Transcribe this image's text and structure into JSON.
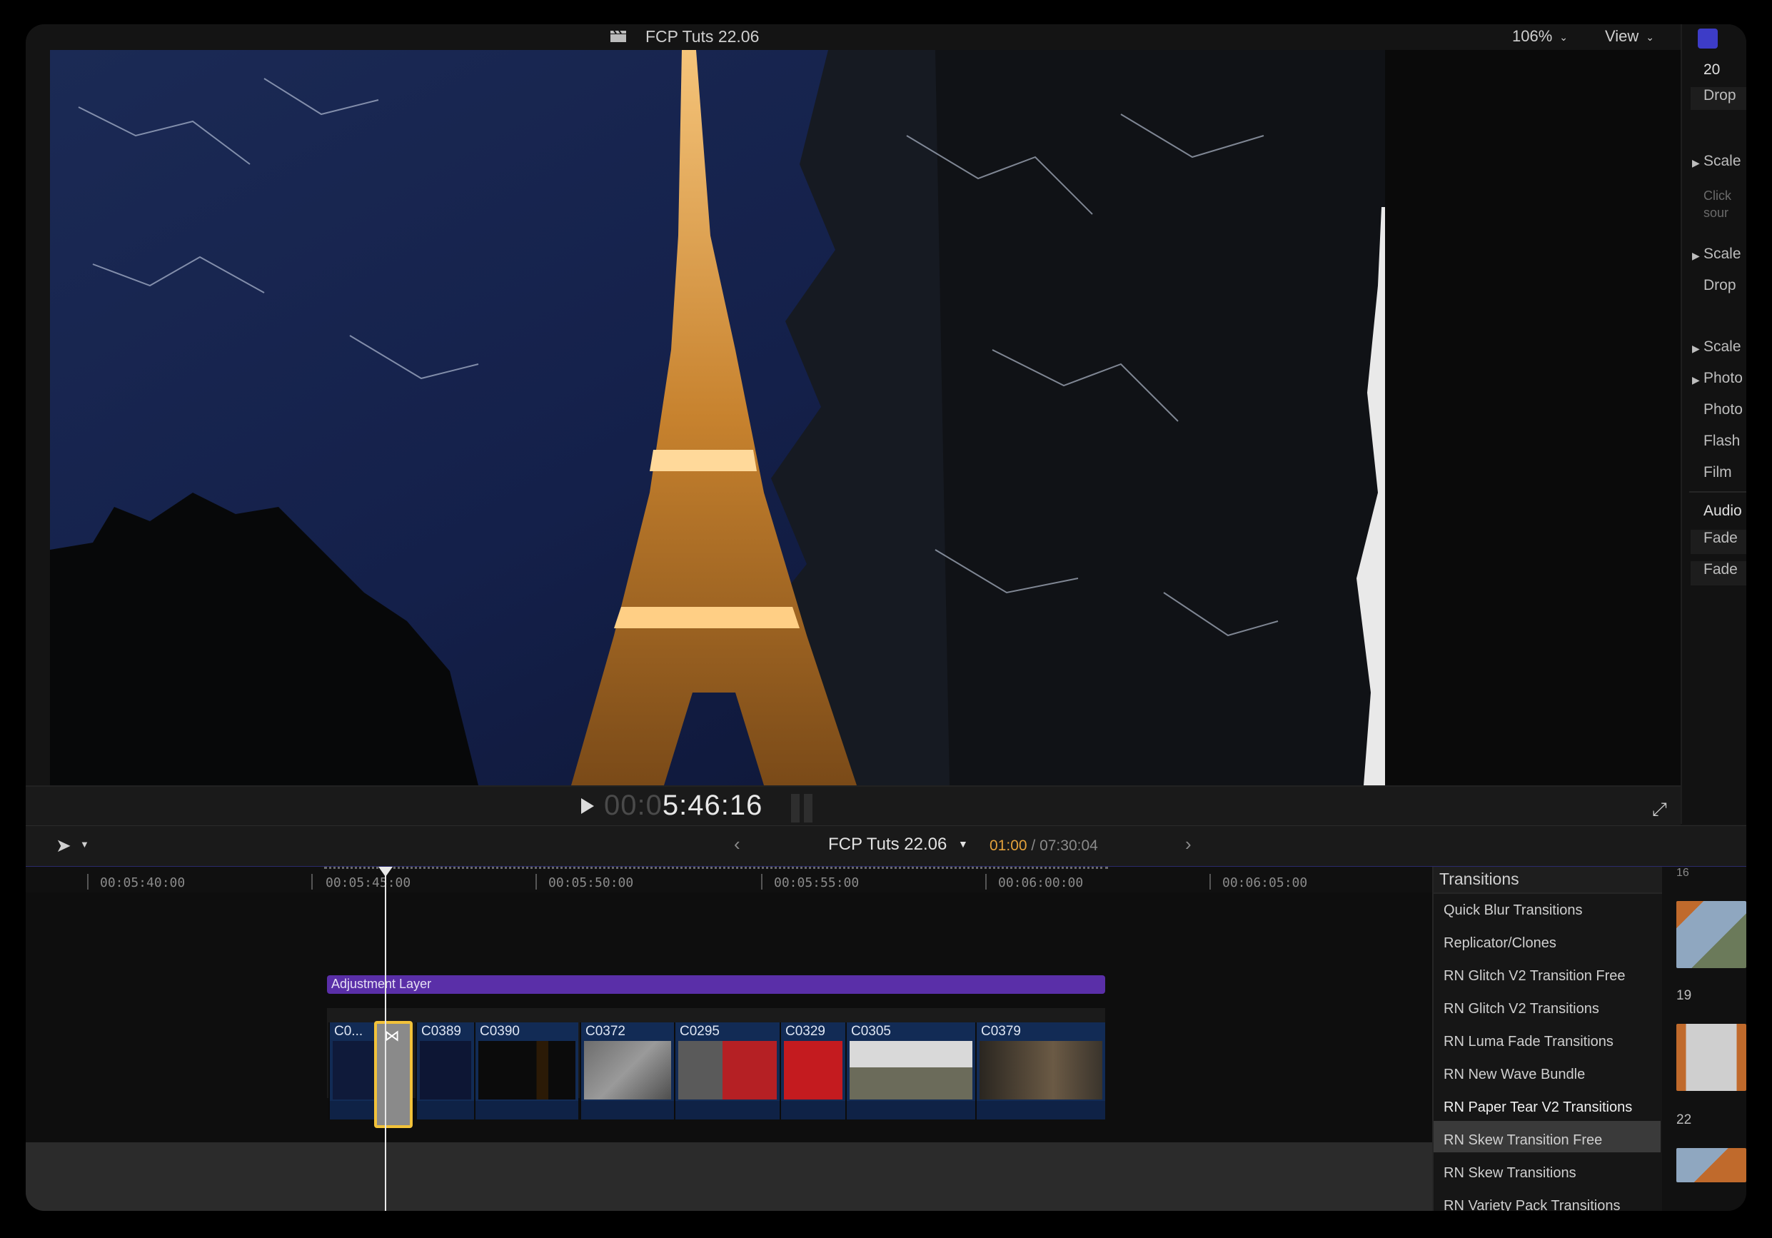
{
  "topbar": {
    "project_title": "FCP Tuts 22.06",
    "zoom_label": "106%",
    "view_label": "View"
  },
  "inspector": {
    "count": "20",
    "rows": [
      "Drop",
      "Scale",
      "Click",
      "sour",
      "Scale",
      "Drop",
      "Scale",
      "Photo",
      "Photo",
      "Flash",
      "Film",
      "Audio",
      "Fade",
      "Fade"
    ]
  },
  "transport": {
    "timecode_dim": "00:0",
    "timecode": "5:46:16"
  },
  "timeline_header": {
    "project": "FCP Tuts 22.06",
    "current": "01:00",
    "separator": " / ",
    "total": "07:30:04"
  },
  "ruler": {
    "labels": [
      "00:05:40:00",
      "00:05:45:00",
      "00:05:50:00",
      "00:05:55:00",
      "00:06:00:00",
      "00:06:05:00"
    ]
  },
  "timeline": {
    "adjustment_layer": "Adjustment Layer",
    "clips": [
      "C0...",
      "C0389",
      "C0390",
      "C0372",
      "C0295",
      "C0329",
      "C0305",
      "C0379"
    ]
  },
  "browser": {
    "title": "Transitions",
    "items": [
      "Quick Blur Transitions",
      "Replicator/Clones",
      "RN Glitch V2 Transition Free",
      "RN Glitch V2 Transitions",
      "RN Luma Fade Transitions",
      "RN New Wave Bundle",
      "RN Paper Tear V2 Transitions",
      "RN Skew Transition Free",
      "RN Skew Transitions",
      "RN Variety Pack Transitions"
    ],
    "selected_index": 6
  },
  "thumbnails": {
    "numbers": [
      "16",
      "19",
      "22"
    ]
  },
  "colors": {
    "accent_yellow": "#f2c23a",
    "timecode_orange": "#e3a13b",
    "adjustment_purple": "#5a2fa8",
    "clip_blue": "#122b55"
  }
}
